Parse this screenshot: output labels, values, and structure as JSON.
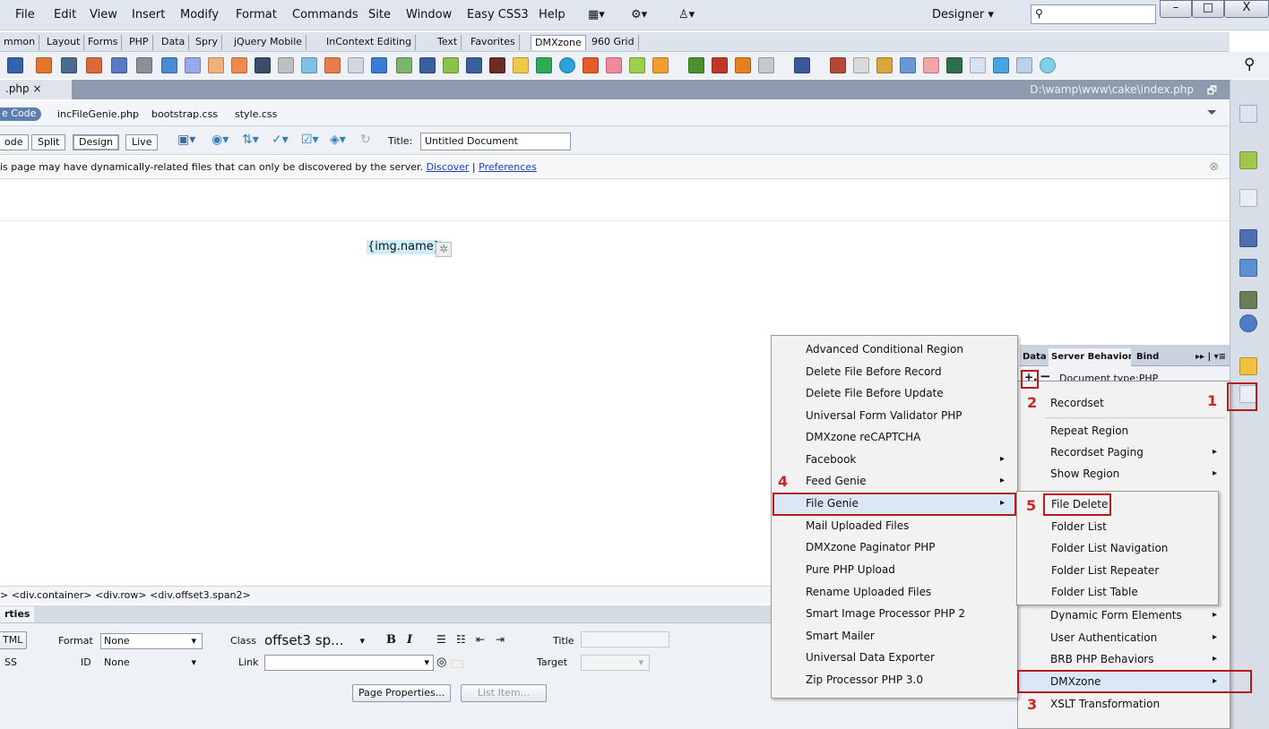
{
  "menubar": {
    "items": [
      "File",
      "Edit",
      "View",
      "Insert",
      "Modify",
      "Format",
      "Commands",
      "Site",
      "Window",
      "Easy CSS3",
      "Help"
    ],
    "workspace": "Designer",
    "window_buttons": [
      "–",
      "□",
      "X"
    ]
  },
  "insert_tabs": [
    "mmon",
    "Layout",
    "Forms",
    "PHP",
    "Data",
    "Spry",
    "jQuery Mobile",
    "InContext Editing",
    "Text",
    "Favorites",
    "DMXzone",
    "960 Grid"
  ],
  "document": {
    "tab_name": ".php",
    "tab_close": "×",
    "path": "D:\\wamp\\www\\cake\\index.php",
    "related_pill": "e Code",
    "related_files": [
      "incFileGenie.php",
      "bootstrap.css",
      "style.css"
    ],
    "views": [
      "ode",
      "Split",
      "Design",
      "Live"
    ],
    "title_label": "Title:",
    "title_value": "Untitled Document",
    "info_text": "is page may have dynamically-related files that can only be discovered by the server.",
    "info_discover": "Discover",
    "info_sep": "|",
    "info_preferences": "Preferences",
    "content_placeholder": "{img.name}"
  },
  "tag_selector": "> <div.container> <div.row> <div.offset3.span2>",
  "properties": {
    "tab": "rties",
    "html_btn": "TML",
    "css_btn": "SS",
    "format_label": "Format",
    "format_value": "None",
    "id_label": "ID",
    "id_value": "None",
    "class_label": "Class",
    "class_value": "offset3 sp...",
    "link_label": "Link",
    "title_label": "Title",
    "target_label": "Target",
    "bold": "B",
    "italic": "I",
    "page_properties": "Page Properties...",
    "list_item": "List Item..."
  },
  "panel": {
    "tabs": [
      "Data",
      "Server Behaviors",
      "Bind"
    ],
    "plus": "+.",
    "minus": "−",
    "doc_type": "Document type:PHP",
    "items": [
      "Recordset",
      "Repeat Region",
      "Recordset Paging",
      "Show Region",
      "Dynamic Form Elements",
      "User Authentication",
      "BRB PHP Behaviors",
      "DMXzone",
      "XSLT Transformation"
    ]
  },
  "dmx_menu": {
    "items": [
      "Advanced Conditional Region",
      "Delete File Before Record",
      "Delete File Before Update",
      "Universal Form Validator PHP",
      "DMXzone reCAPTCHA",
      "Facebook",
      "Feed Genie",
      "File Genie",
      "Mail Uploaded Files",
      "DMXzone Paginator PHP",
      "Pure PHP Upload",
      "Rename Uploaded Files",
      "Smart Image Processor PHP 2",
      "Smart Mailer",
      "Universal Data Exporter",
      "Zip Processor PHP 3.0"
    ]
  },
  "file_genie_menu": {
    "items": [
      "File Delete",
      "Folder List",
      "Folder List Navigation",
      "Folder List Repeater",
      "Folder List Table"
    ]
  },
  "callouts": [
    "1",
    "2",
    "3",
    "4",
    "5"
  ],
  "colors": {
    "accent_red": "#c62828",
    "highlight": "#dbe7f7",
    "doc_tab": "#8e9aad"
  }
}
